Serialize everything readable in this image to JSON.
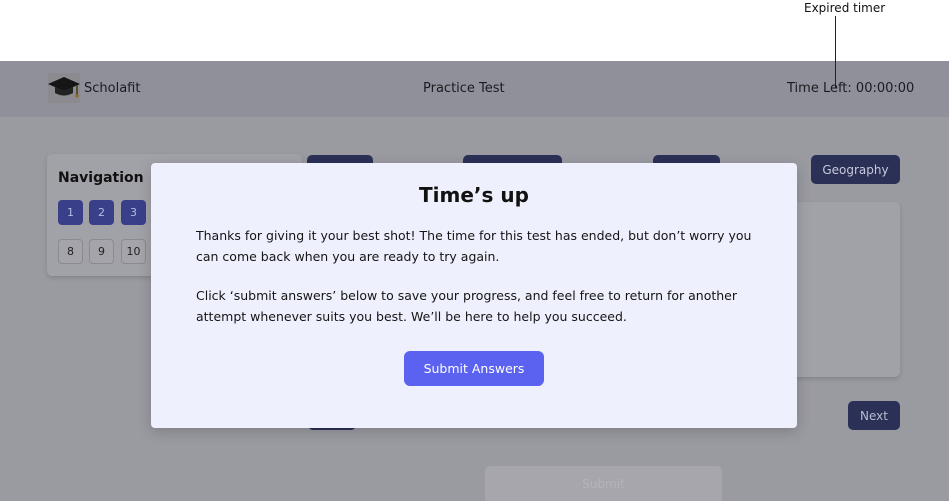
{
  "annotation": {
    "label": "Expired timer"
  },
  "header": {
    "brand": "Scholafit",
    "title": "Practice Test",
    "timer": "Time Left: 00:00:00"
  },
  "navigation": {
    "title": "Navigation",
    "answered": [
      "1",
      "2",
      "3"
    ],
    "unanswered": [
      "8",
      "9",
      "10"
    ]
  },
  "tabs": {
    "geography": "Geography"
  },
  "controls": {
    "next": "Next",
    "submit": "Submit"
  },
  "modal": {
    "title": "Time’s up",
    "paragraph1": "Thanks for giving it your best shot! The time for this test has ended, but don’t worry you can come back when you are ready to try again.",
    "paragraph2": "Click ‘submit answers’ below to save your progress, and feel free to return for another attempt whenever suits you best. We’ll be here to help you succeed.",
    "submit_label": "Submit Answers"
  },
  "colors": {
    "accent": "#5b62f0",
    "modal_bg": "#eff0fd",
    "dark_button": "#2b3057"
  }
}
